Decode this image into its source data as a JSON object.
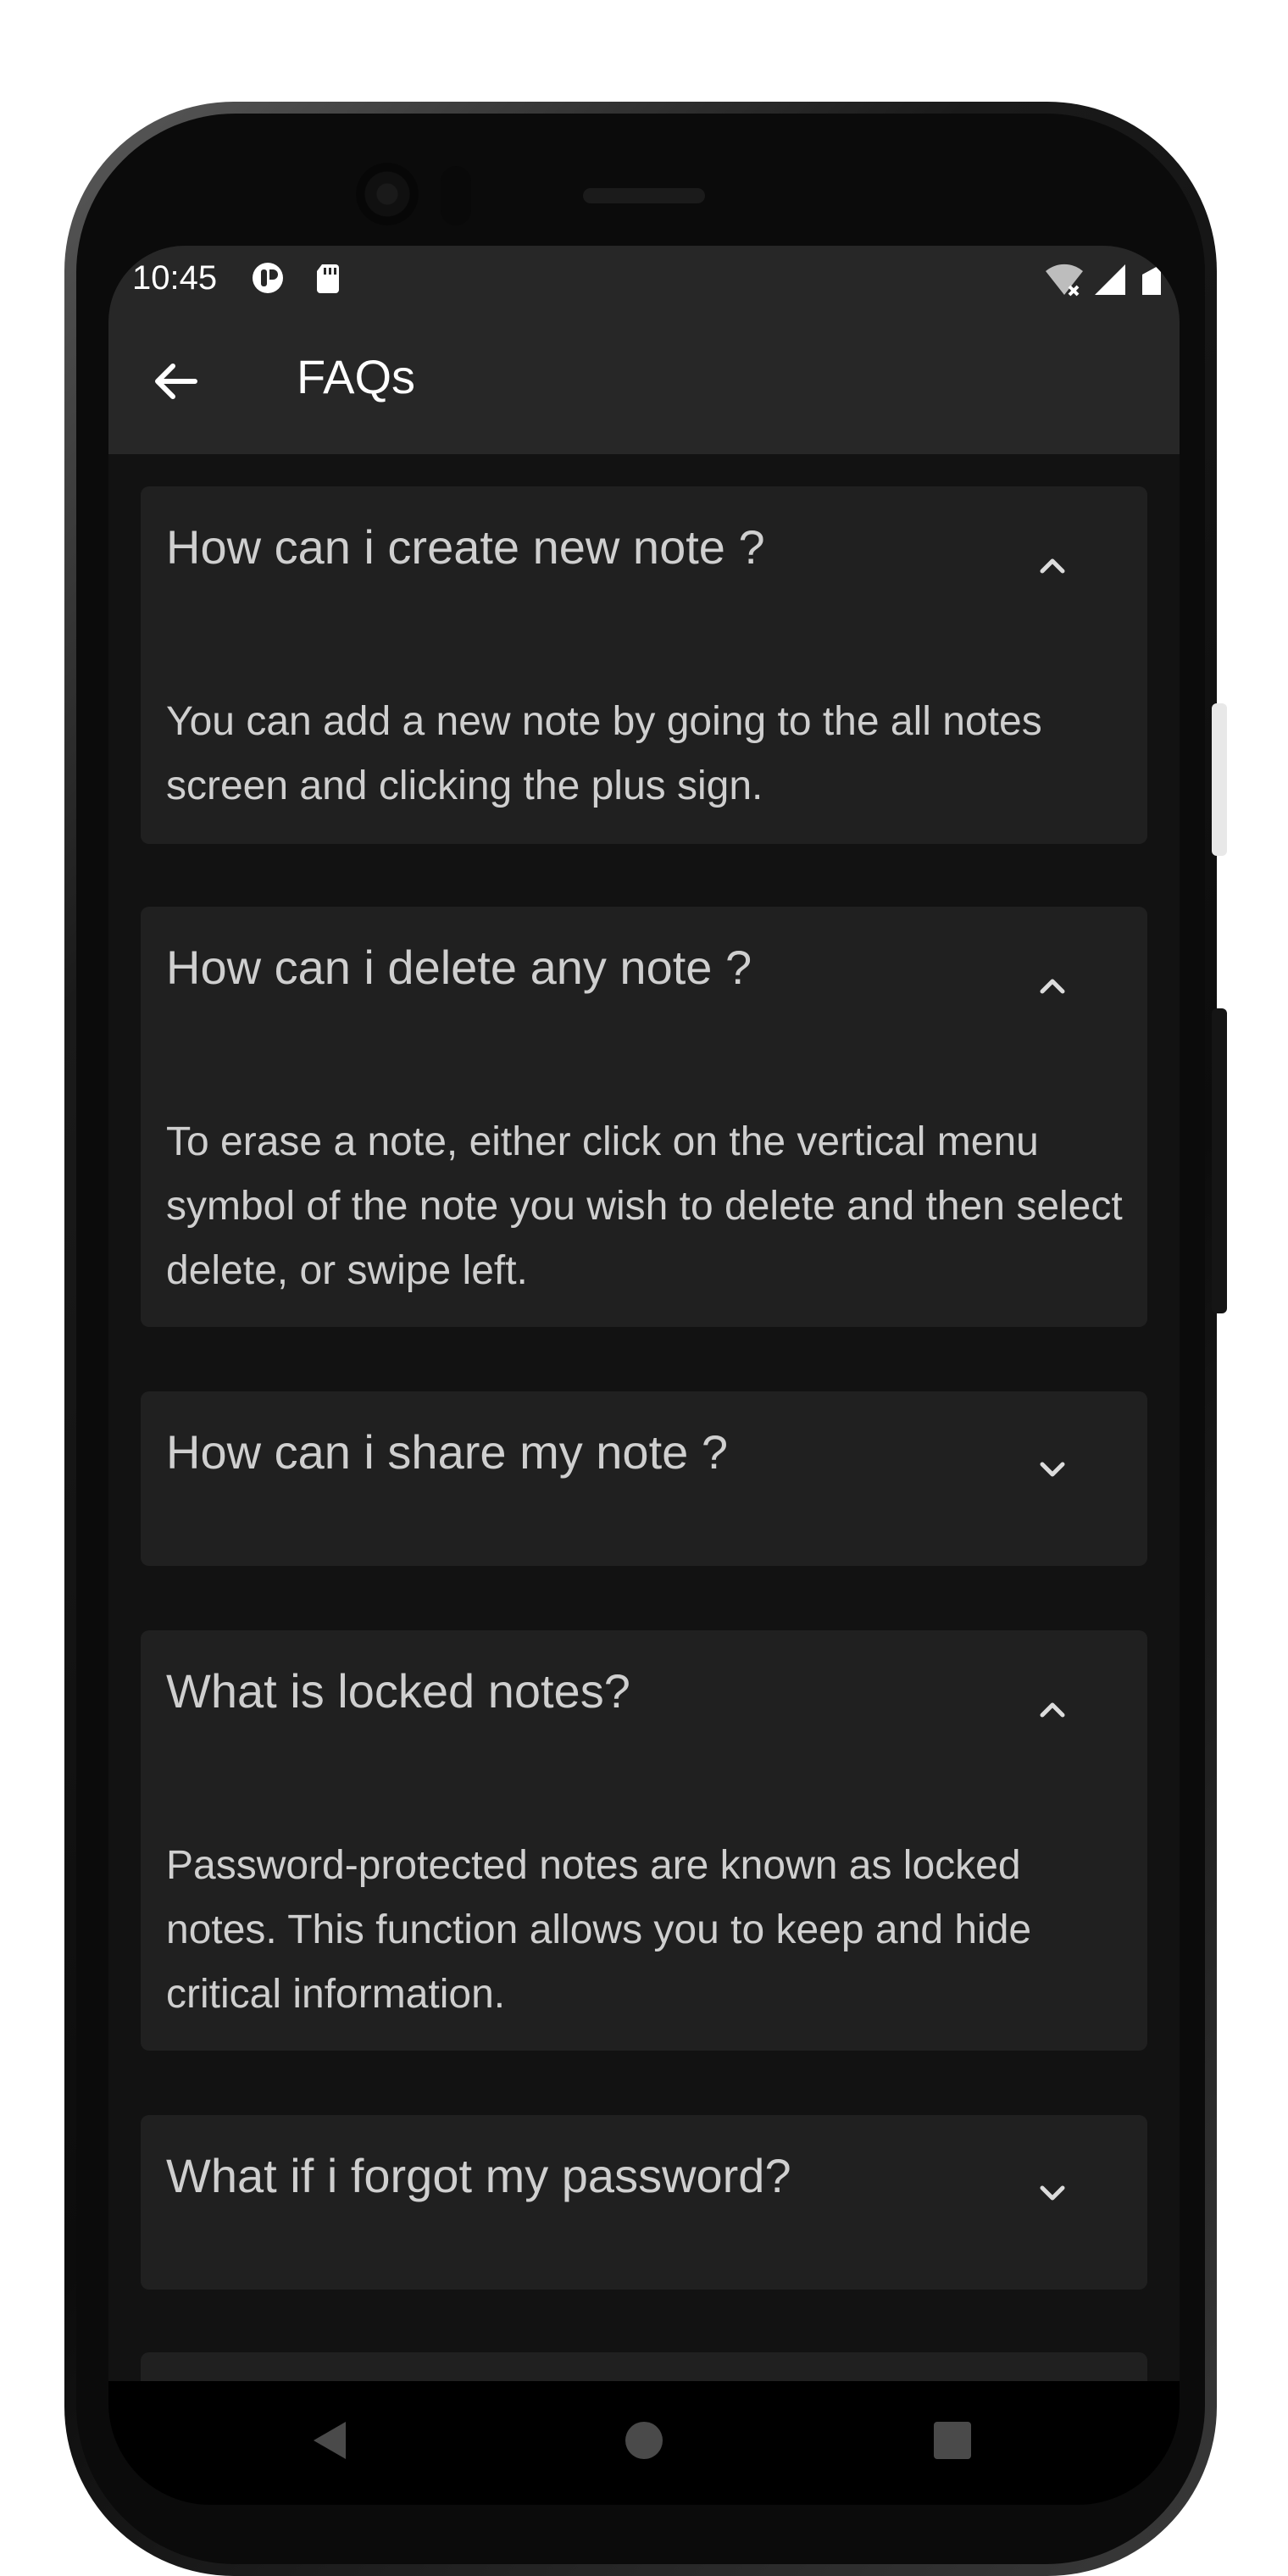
{
  "status_bar": {
    "time": "10:45",
    "icons": [
      "notification-icon",
      "sd-card-icon",
      "wifi-off-icon",
      "signal-icon",
      "battery-icon"
    ]
  },
  "app_bar": {
    "title": "FAQs",
    "back_icon": "arrow-back-icon"
  },
  "faqs": [
    {
      "question": "How can i create new note ?",
      "answer": "You can add a new note by going to the all notes screen and clicking the plus sign.",
      "expanded": true
    },
    {
      "question": "How can i delete any note ?",
      "answer": "To erase a note, either click on the vertical menu symbol of the note you wish to delete and then select delete, or swipe left.",
      "expanded": true
    },
    {
      "question": "How can i share my note ?",
      "answer": "",
      "expanded": false
    },
    {
      "question": "What is locked notes?",
      "answer": "Password-protected notes are known as locked notes. This function allows you to keep and hide critical information.",
      "expanded": true
    },
    {
      "question": "What if i forgot my password?",
      "answer": "",
      "expanded": false
    }
  ],
  "nav_bar": {
    "icons": [
      "back-triangle-icon",
      "home-circle-icon",
      "recents-square-icon"
    ]
  },
  "colors": {
    "screen_bg": "#121212",
    "app_bar_bg": "#272727",
    "card_bg": "#202020",
    "text": "#cfcfcf"
  }
}
